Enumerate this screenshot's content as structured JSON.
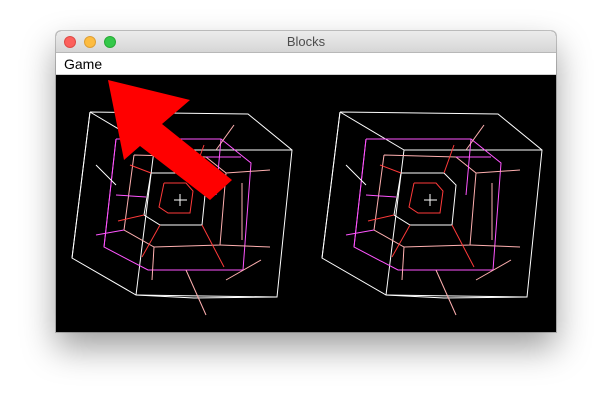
{
  "window": {
    "title": "Blocks"
  },
  "menu": {
    "items": [
      {
        "label": "Game"
      }
    ]
  },
  "scene": {
    "description_icons": [
      "cube-wireframe-left",
      "cube-wireframe-right"
    ],
    "background_color": "#000000",
    "line_colors": [
      "#ffffff",
      "#ff55ff",
      "#ff3a3a",
      "#ffb0b0"
    ]
  },
  "annotation": {
    "arrow_color": "#ff0000"
  }
}
